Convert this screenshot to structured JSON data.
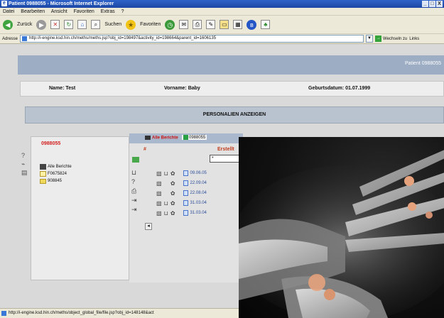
{
  "window": {
    "title": "Patient 0988055 - Microsoft Internet Explorer",
    "buttons": [
      "_",
      "□",
      "X"
    ]
  },
  "menu": [
    "Datei",
    "Bearbeiten",
    "Ansicht",
    "Favoriten",
    "Extras",
    "?"
  ],
  "toolbar": {
    "back_label": "Zurück",
    "search_label": "Suchen",
    "favorites_label": "Favoriten"
  },
  "address": {
    "label": "Adresse",
    "url": "http://i-engine.ksd.hin.ch/meths/meths.jsp?obj_id=198497&activity_id=198664&parent_id=1606135",
    "go_label": "Wechseln zu",
    "links_label": "Links"
  },
  "banner": {
    "patient": "Patient 0988055"
  },
  "patient": {
    "name": "Name: Test",
    "vorname": "Vorname: Baby",
    "geburtsdatum": "Geburtsdatum: 01.07.1999"
  },
  "show_personal": "PERSONALIEN ANZEIGEN",
  "left": {
    "pid": "0988055",
    "tree": [
      {
        "label": "Alle Berichte",
        "icon": "cabinet"
      },
      {
        "label": "F0675824",
        "icon": "document"
      },
      {
        "label": "908845",
        "icon": "folder"
      }
    ]
  },
  "right": {
    "tab_all": "Alle Berichte",
    "tab_patient": "0988055",
    "col_hash": "#",
    "col_created": "Erstellt",
    "filter_value": "*",
    "dates": [
      "09.06.05",
      "22.09.04",
      "22.08.04",
      "31.03.04",
      "31.03.04"
    ]
  },
  "status": {
    "text": "http://i-engine.ksd.hin.ch/meths/object_global_file/file.jsp?obj_id=148148&act"
  }
}
